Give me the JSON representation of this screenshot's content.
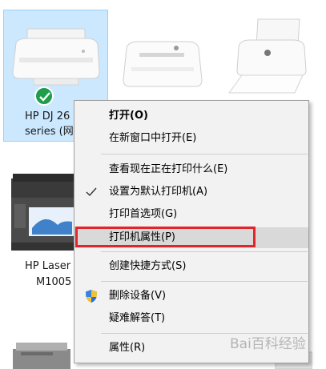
{
  "printers": [
    {
      "label_line1": "HP DJ 26",
      "label_line2": "series (网"
    },
    {
      "label_line1": "HP Laser",
      "label_line2": "M1005"
    }
  ],
  "context_menu": {
    "items": [
      {
        "label": "打开(O)"
      },
      {
        "label": "在新窗口中打开(E)"
      },
      {
        "label": "查看现在正在打印什么(E)"
      },
      {
        "label": "设置为默认打印机(A)"
      },
      {
        "label": "打印首选项(G)"
      },
      {
        "label": "打印机属性(P)"
      },
      {
        "label": "创建快捷方式(S)"
      },
      {
        "label": "删除设备(V)"
      },
      {
        "label": "疑难解答(T)"
      },
      {
        "label": "属性(R)"
      }
    ]
  },
  "watermark": "Bai百科经验",
  "colors": {
    "highlight": "#e0262b",
    "selection": "#cce8ff",
    "default_check": "#1e9e4a"
  }
}
